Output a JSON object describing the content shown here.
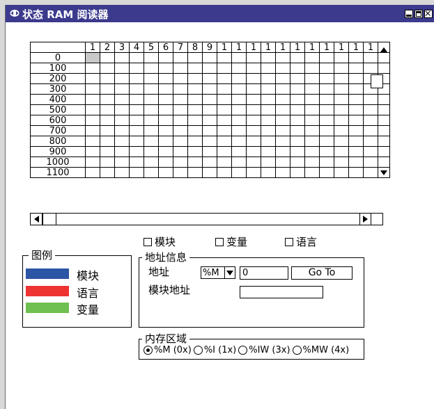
{
  "window": {
    "title": "状态 RAM 阅读器",
    "title_bar_color": "#3b3a8d",
    "title_icon": "diamond-arrows-icon",
    "controls": [
      "minimize-icon",
      "maximize-icon",
      "close-icon"
    ]
  },
  "grid": {
    "column_headers": [
      "1",
      "2",
      "3",
      "4",
      "5",
      "6",
      "7",
      "8",
      "9",
      "1",
      "1",
      "1",
      "1",
      "1",
      "1",
      "1",
      "1",
      "1",
      "1",
      "1"
    ],
    "row_headers": [
      "0",
      "100",
      "200",
      "300",
      "400",
      "500",
      "600",
      "700",
      "800",
      "900",
      "1000",
      "1100"
    ],
    "selected_cell_color": "#c9c9c9"
  },
  "filters": {
    "module": "模块",
    "variable": "变量",
    "language": "语言"
  },
  "legend": {
    "title": "图例",
    "items": [
      {
        "label": "模块",
        "color": "#2d55a6"
      },
      {
        "label": "语言",
        "color": "#ee3333"
      },
      {
        "label": "变量",
        "color": "#6fc050"
      }
    ]
  },
  "address_info": {
    "title": "地址信息",
    "address_label": "地址",
    "type_selected": "%M",
    "address_value": "0",
    "goto_label": "Go To",
    "module_address_label": "模块地址",
    "module_address_value": ""
  },
  "memory_area": {
    "title": "内存区域",
    "options": [
      "%M (0x)",
      "%I (1x)",
      "%IW (3x)",
      "%MW (4x)"
    ],
    "selected_index": 0
  }
}
